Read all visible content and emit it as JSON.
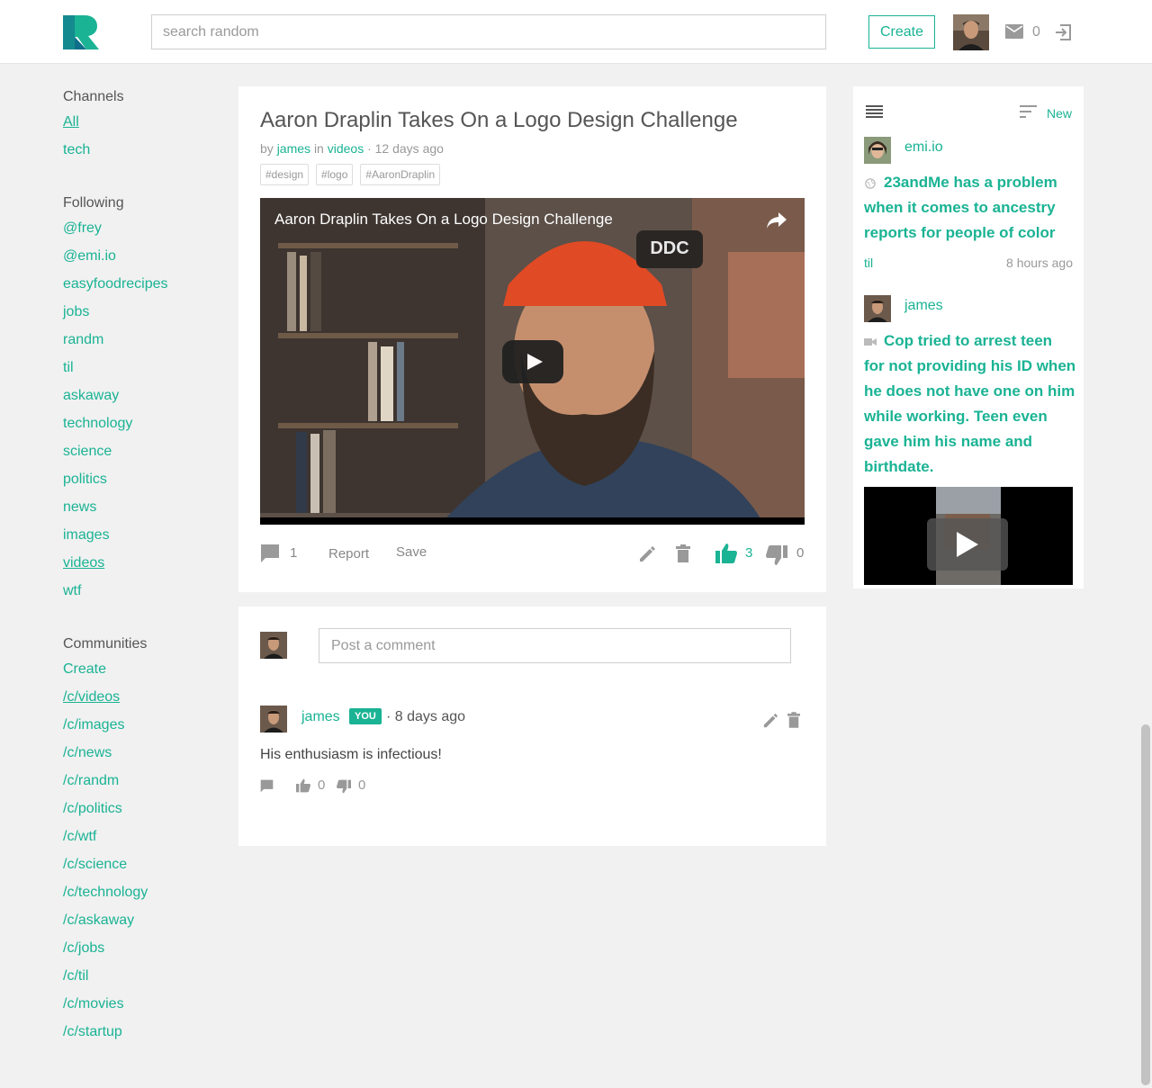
{
  "header": {
    "search_placeholder": "search random",
    "create_label": "Create",
    "mail_count": "0"
  },
  "sidebar": {
    "channels_heading": "Channels",
    "channels": [
      "All",
      "tech"
    ],
    "following_heading": "Following",
    "following": [
      "@frey",
      "@emi.io",
      "easyfoodrecipes",
      "jobs",
      "randm",
      "til",
      "askaway",
      "technology",
      "science",
      "politics",
      "news",
      "images",
      "videos",
      "wtf"
    ],
    "communities_heading": "Communities",
    "communities": [
      "Create",
      "/c/videos",
      "/c/images",
      "/c/news",
      "/c/randm",
      "/c/politics",
      "/c/wtf",
      "/c/science",
      "/c/technology",
      "/c/askaway",
      "/c/jobs",
      "/c/til",
      "/c/movies",
      "/c/startup"
    ]
  },
  "post": {
    "title": "Aaron Draplin Takes On a Logo Design Challenge",
    "by": "by",
    "author": "james",
    "in": "in",
    "channel": "videos",
    "age": "· 12 days ago",
    "tags": [
      "#design",
      "#logo",
      "#AaronDraplin"
    ],
    "video_title": "Aaron Draplin Takes On a Logo Design Challenge",
    "comment_count": "1",
    "report_label": "Report",
    "save_label": "Save",
    "upvotes": "3",
    "downvotes": "0"
  },
  "comments": {
    "placeholder": "Post a comment",
    "items": [
      {
        "author": "james",
        "badge": "YOU",
        "age": "· 8 days ago",
        "text": "His enthusiasm is infectious!",
        "upvotes": "0",
        "downvotes": "0"
      }
    ]
  },
  "feed": {
    "sort_label": "New",
    "items": [
      {
        "author": "emi.io",
        "title": "23andMe has a problem when it comes to ancestry reports for people of color",
        "channel": "til",
        "age": "8 hours ago",
        "type_icon": "globe-icon"
      },
      {
        "author": "james",
        "title": "Cop tried to arrest teen for not providing his ID when he does not have one on him while working. Teen even gave him his name and birthdate.",
        "type_icon": "video-camera-icon"
      }
    ]
  },
  "colors": {
    "accent": "#1ab394",
    "background": "#f1f1f1"
  }
}
